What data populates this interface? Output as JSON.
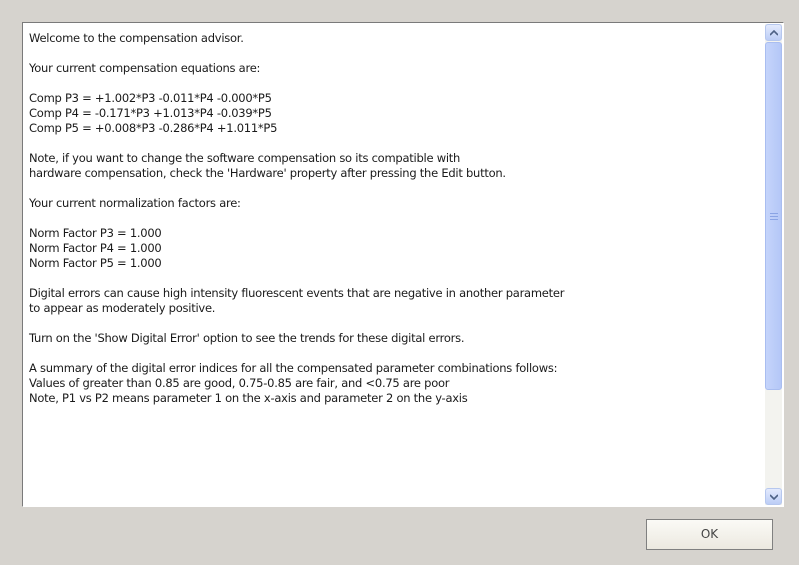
{
  "advisor": {
    "lines": [
      "Welcome to the compensation advisor.",
      "",
      "Your current compensation equations are:",
      "",
      "Comp P3 = +1.002*P3 -0.011*P4 -0.000*P5",
      "Comp P4 = -0.171*P3 +1.013*P4 -0.039*P5",
      "Comp P5 = +0.008*P3 -0.286*P4 +1.011*P5",
      "",
      "Note, if you want to change the software compensation so its compatible with",
      "hardware compensation, check the 'Hardware' property after pressing the Edit button.",
      "",
      "Your current normalization factors are:",
      "",
      "Norm Factor P3 = 1.000",
      "Norm Factor P4 = 1.000",
      "Norm Factor P5 = 1.000",
      "",
      "Digital errors can cause high intensity fluorescent events that are negative in another parameter",
      "to appear as moderately positive.",
      "",
      "Turn on the 'Show Digital Error' option to see the trends for these digital errors.",
      "",
      "A summary of the digital error indices for all the compensated parameter combinations follows:",
      "Values of greater than 0.85 are good, 0.75-0.85 are fair, and <0.75 are poor",
      "Note, P1 vs P2 means parameter 1 on the x-axis and parameter 2 on the y-axis"
    ]
  },
  "buttons": {
    "ok_label": "OK"
  },
  "icons": {
    "scroll_up": "chevron-up-icon",
    "scroll_down": "chevron-down-icon"
  },
  "colors": {
    "dialog_background": "#d6d3ce",
    "scrollbar_accent": "#bccdf6"
  }
}
